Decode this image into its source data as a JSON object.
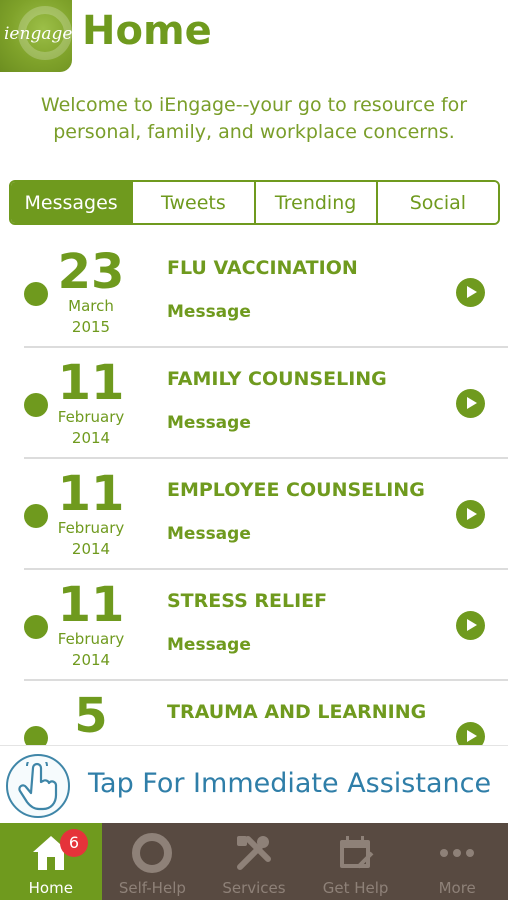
{
  "header": {
    "logo_text": "iengage",
    "title": "Home"
  },
  "welcome": {
    "line1": "Welcome to iEngage--your go to resource for",
    "line2": "personal, family, and workplace  concerns."
  },
  "tabs": [
    {
      "label": "Messages",
      "active": true
    },
    {
      "label": "Tweets",
      "active": false
    },
    {
      "label": "Trending",
      "active": false
    },
    {
      "label": "Social",
      "active": false
    }
  ],
  "messages": [
    {
      "day": "23",
      "month": "March",
      "year": "2015",
      "title": "FLU VACCINATION",
      "type": "Message"
    },
    {
      "day": "11",
      "month": "February",
      "year": "2014",
      "title": "FAMILY COUNSELING",
      "type": "Message"
    },
    {
      "day": "11",
      "month": "February",
      "year": "2014",
      "title": "EMPLOYEE COUNSELING",
      "type": "Message"
    },
    {
      "day": "11",
      "month": "February",
      "year": "2014",
      "title": "STRESS RELIEF",
      "type": "Message"
    },
    {
      "day": "5",
      "month": "",
      "year": "",
      "title": "TRAUMA AND LEARNING",
      "type": ""
    }
  ],
  "assist": {
    "label": "Tap For Immediate Assistance",
    "icon": "hand-pointer-icon"
  },
  "tabbar": [
    {
      "label": "Home",
      "icon": "home-icon",
      "badge": "6",
      "active": true
    },
    {
      "label": "Self-Help",
      "icon": "lifebuoy-icon",
      "active": false
    },
    {
      "label": "Services",
      "icon": "tools-icon",
      "active": false
    },
    {
      "label": "Get Help",
      "icon": "calendar-icon",
      "active": false
    },
    {
      "label": "More",
      "icon": "more-dots-icon",
      "active": false
    }
  ],
  "colors": {
    "accent": "#6f9a1e",
    "assist_blue": "#2f7ea8",
    "tabbar_bg": "#584a41",
    "badge_red": "#e5333a"
  }
}
